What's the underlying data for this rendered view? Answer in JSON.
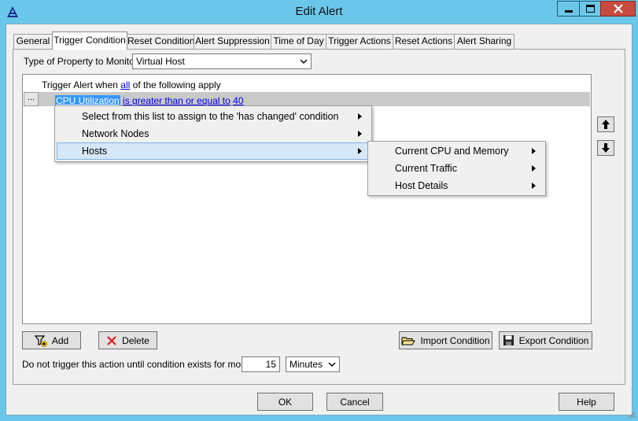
{
  "window": {
    "title": "Edit Alert",
    "accent": "#6bc7ea",
    "close_color": "#c74b3f"
  },
  "tabs": [
    {
      "label": "General"
    },
    {
      "label": "Trigger Condition",
      "active": true
    },
    {
      "label": "Reset Condition"
    },
    {
      "label": "Alert Suppression"
    },
    {
      "label": "Time of Day"
    },
    {
      "label": "Trigger Actions"
    },
    {
      "label": "Reset Actions"
    },
    {
      "label": "Alert Sharing"
    }
  ],
  "property": {
    "label": "Type of Property to Monitor:",
    "value": "Virtual Host"
  },
  "trigger": {
    "prefix": "Trigger Alert when",
    "quantifier": "all",
    "suffix": "of the following apply",
    "ellipsis": "...",
    "condition": {
      "field": "CPU Utilization",
      "operator": "is greater than or equal to",
      "value": "40"
    }
  },
  "context_menu": {
    "items": [
      {
        "label": "Select from this list to assign to the 'has changed' condition"
      },
      {
        "label": "Network Nodes"
      },
      {
        "label": "Hosts",
        "highlighted": true
      }
    ]
  },
  "submenu": {
    "items": [
      {
        "label": "Current CPU and Memory"
      },
      {
        "label": "Current Traffic"
      },
      {
        "label": "Host Details"
      }
    ]
  },
  "buttons": {
    "add": "Add",
    "delete": "Delete",
    "import": "Import Condition",
    "export": "Export Condition",
    "ok": "OK",
    "cancel": "Cancel",
    "help": "Help"
  },
  "duration": {
    "label": "Do not trigger this action until condition exists for more than",
    "value": "15",
    "unit": "Minutes"
  }
}
